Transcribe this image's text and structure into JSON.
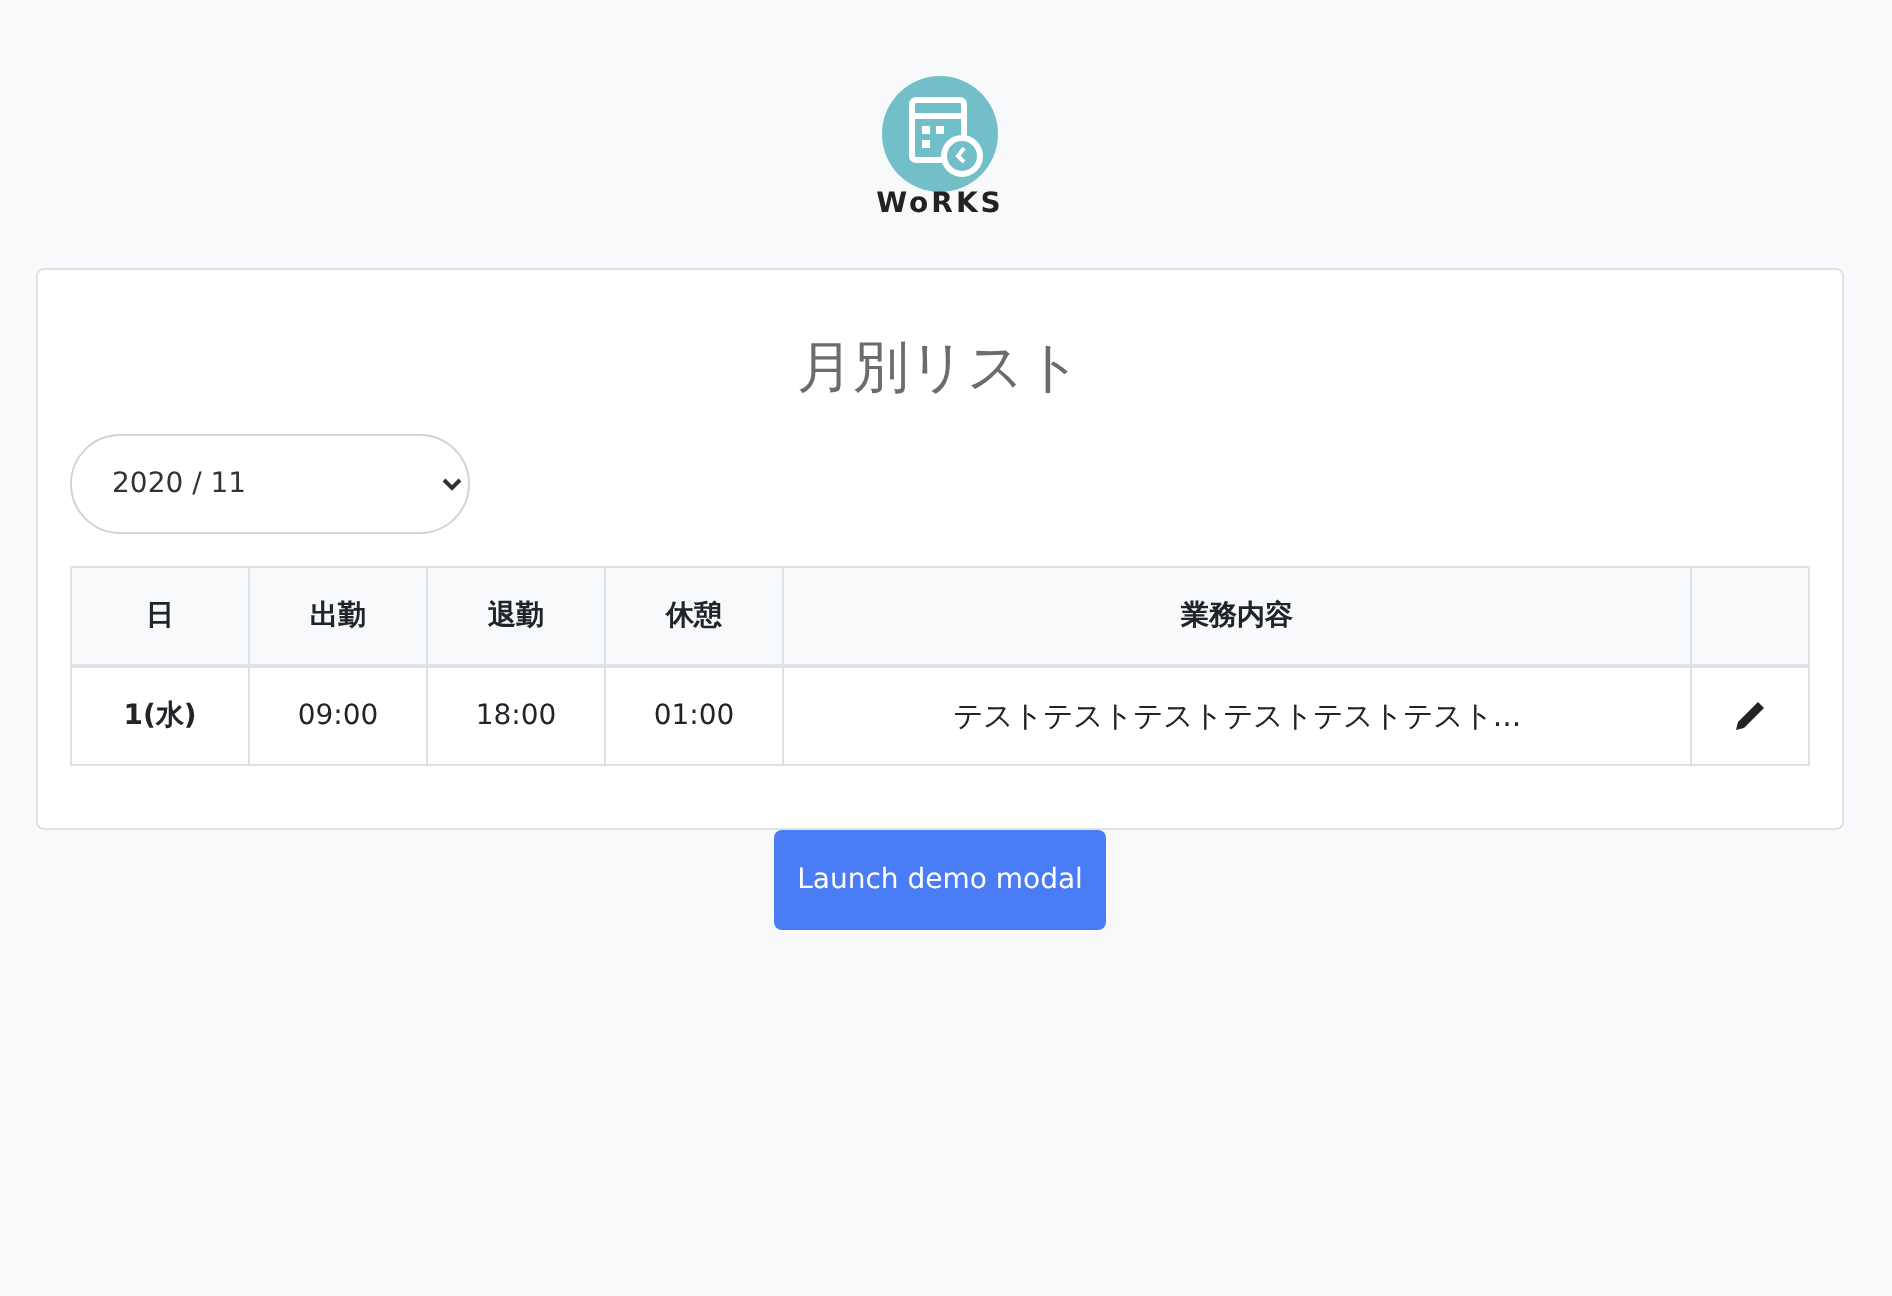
{
  "logo": {
    "wordmark": "WoRKS"
  },
  "title": "月別リスト",
  "month_select": {
    "value": "2020 / 11"
  },
  "table": {
    "columns": [
      "日",
      "出勤",
      "退勤",
      "休憩",
      "業務内容"
    ],
    "rows": [
      {
        "day": "1(水)",
        "start": "09:00",
        "end": "18:00",
        "break": "01:00",
        "work": "テストテストテストテストテストテスト..."
      }
    ]
  },
  "button": "Launch demo modal"
}
